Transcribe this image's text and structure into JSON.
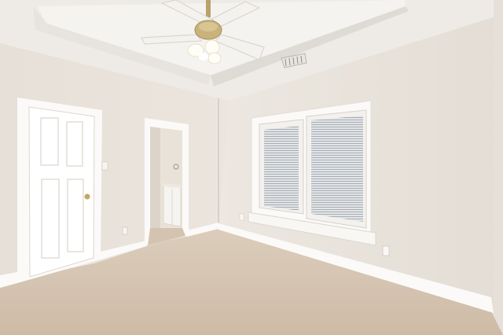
{
  "scene": {
    "subject": "empty-bedroom",
    "colors": {
      "ceiling": "#f1efec",
      "tray_ceiling": "#f6f4f1",
      "wall_left": "#e8e2da",
      "wall_right": "#ebe6df",
      "wall_back": "#e4ddd4",
      "trim": "#fbfaf8",
      "carpet": "#d8c8b6",
      "blind": "#d9dcdf",
      "fan_brass": "#b9a26d",
      "light": "#fffef6"
    },
    "icons": [
      "ceiling-fan-icon",
      "air-vent-icon",
      "door-icon",
      "window-icon",
      "outlet-icon",
      "light-switch-icon"
    ]
  }
}
